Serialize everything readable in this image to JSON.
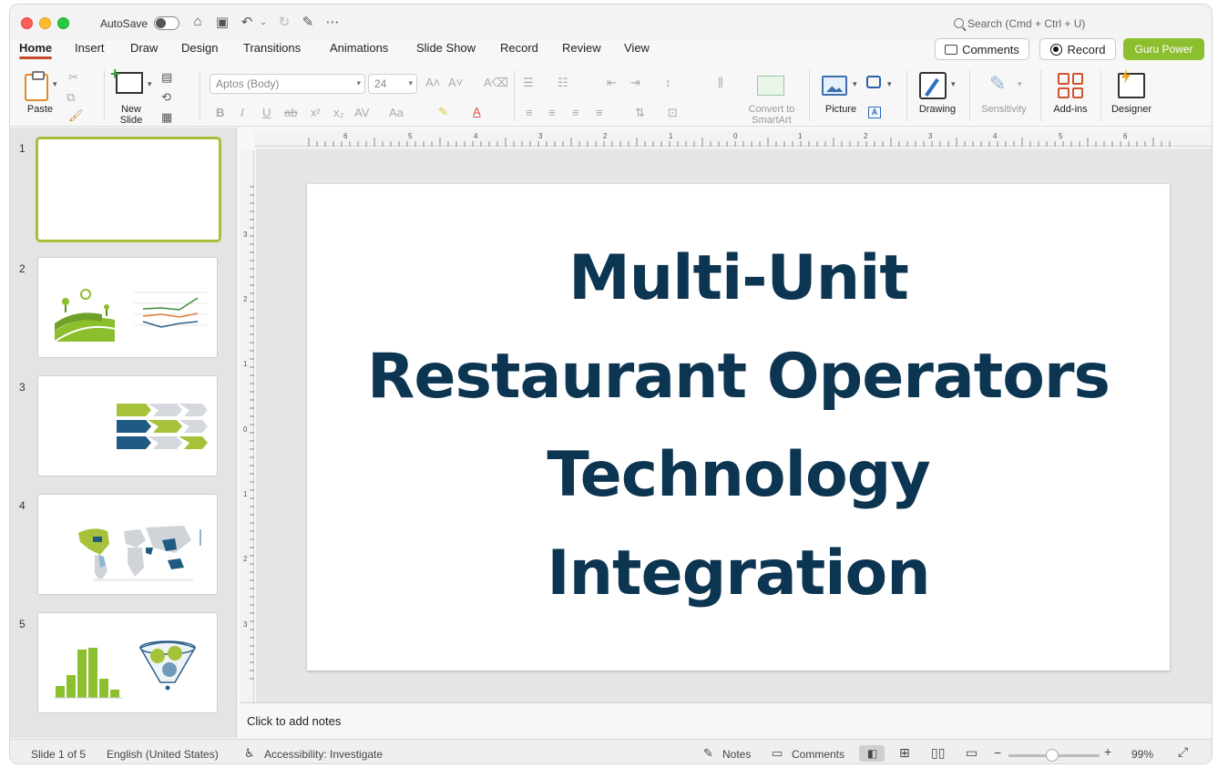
{
  "titlebar": {
    "autosave_label": "AutoSave",
    "search_placeholder": "Search (Cmd + Ctrl + U)"
  },
  "tabs": [
    {
      "label": "Home",
      "active": true
    },
    {
      "label": "Insert"
    },
    {
      "label": "Draw"
    },
    {
      "label": "Design"
    },
    {
      "label": "Transitions"
    },
    {
      "label": "Animations"
    },
    {
      "label": "Slide Show"
    },
    {
      "label": "Record"
    },
    {
      "label": "Review"
    },
    {
      "label": "View"
    }
  ],
  "actions": {
    "comments": "Comments",
    "record": "Record",
    "guru": "Guru Power"
  },
  "ribbon": {
    "paste": "Paste",
    "new_slide_line1": "New",
    "new_slide_line2": "Slide",
    "font_name": "Aptos (Body)",
    "font_size": "24",
    "convert_line1": "Convert to",
    "convert_line2": "SmartArt",
    "picture": "Picture",
    "drawing": "Drawing",
    "sensitivity": "Sensitivity",
    "addins": "Add-ins",
    "designer": "Designer"
  },
  "thumbnails": [
    "1",
    "2",
    "3",
    "4",
    "5"
  ],
  "slide": {
    "title_lines": [
      "Multi-Unit",
      "Restaurant Operators",
      "Technology",
      "Integration"
    ]
  },
  "ruler": {
    "h_ticks": [
      "6",
      "5",
      "4",
      "3",
      "2",
      "1",
      "0",
      "1",
      "2",
      "3",
      "4",
      "5",
      "6"
    ],
    "v_ticks": [
      "3",
      "2",
      "1",
      "0",
      "1",
      "2",
      "3"
    ]
  },
  "notes_placeholder": "Click to add notes",
  "status": {
    "slide_of": "Slide 1 of 5",
    "language": "English (United States)",
    "accessibility": "Accessibility: Investigate",
    "notes": "Notes",
    "comments": "Comments",
    "zoom": "99%"
  },
  "colors": {
    "title_navy": "#0c3552",
    "accent_green": "#8cbf2e",
    "tab_underline": "#c44a2b"
  }
}
